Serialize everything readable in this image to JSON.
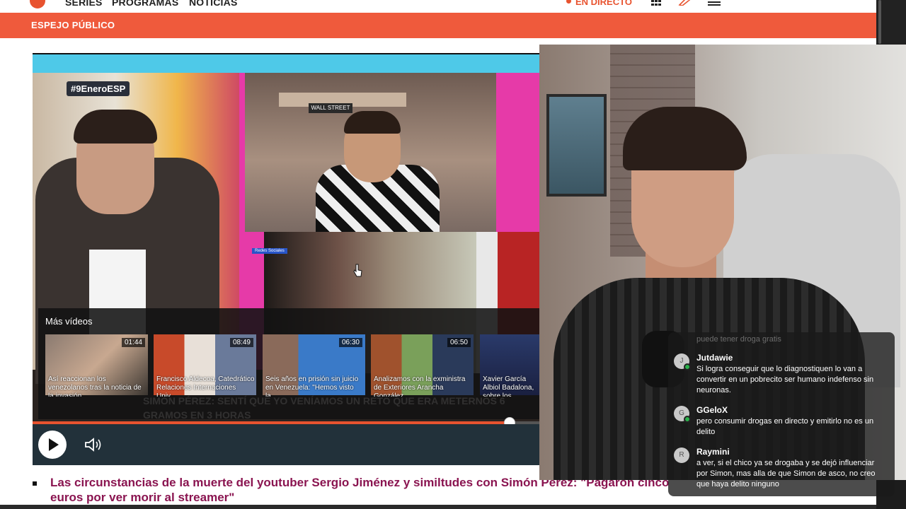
{
  "nav": {
    "items": [
      "SERIES",
      "PROGRAMAS",
      "NOTICIAS"
    ],
    "live_label": "EN DIRECTO",
    "icons": [
      "grid-icon",
      "pencil-icon",
      "menu-icon"
    ]
  },
  "section": {
    "label": "ESPEJO PÚBLICO"
  },
  "player": {
    "hashtag": "#9EneroESP",
    "ws_sign": "WALL STREET",
    "blur_tag": "Redes Sociales",
    "more_videos_title": "Más vídeos",
    "ghost_title": "SIMÓN PÉREZ: SENTÍ QUE YO VENÍAMOS UN RETO QUE ERA METERNOS 6 GRAMOS EN 3 HORAS",
    "progress": 0.94,
    "colors": {
      "accent": "#e8532f",
      "controls": "#22313a"
    },
    "videos": [
      {
        "duration": "01:44",
        "caption": "Así reaccionan los venezolanos tras la noticia de la invasión..."
      },
      {
        "duration": "08:49",
        "caption": "Francisco Aldecoa, Catedrático Relaciones Internaciones Univ..."
      },
      {
        "duration": "06:30",
        "caption": "Seis años en prisión sin juicio en Venezuela: \"Hemos visto la..."
      },
      {
        "duration": "06:50",
        "caption": "Analizamos con la exministra de Exteriores Arancha González..."
      },
      {
        "duration": "",
        "caption": "Xavier García Albiol Badalona, sobre los"
      }
    ]
  },
  "headline": "Las circunstancias de la muerte del youtuber Sergio Jiménez y similtudes con Simón Pérez: \"Pagaron cinco euros por ver morir al streamer\"",
  "chat": {
    "fade_text": "puede tener droga gratis",
    "messages": [
      {
        "initial": "J",
        "user": "Jutdawie",
        "text": "Si logra conseguir que lo diagnostiquen lo van a convertir en un pobrecito ser humano indefenso sin neuronas."
      },
      {
        "initial": "G",
        "user": "GGeloX",
        "text": "pero consumir drogas en directo y emitirlo no es un delito"
      },
      {
        "initial": "R",
        "user": "Raymini",
        "text": "a ver, si el chico ya se drogaba y se dejó influenciar por Simon, mas alla de que Simon de asco, no creo que haya delito ninguno"
      }
    ]
  }
}
